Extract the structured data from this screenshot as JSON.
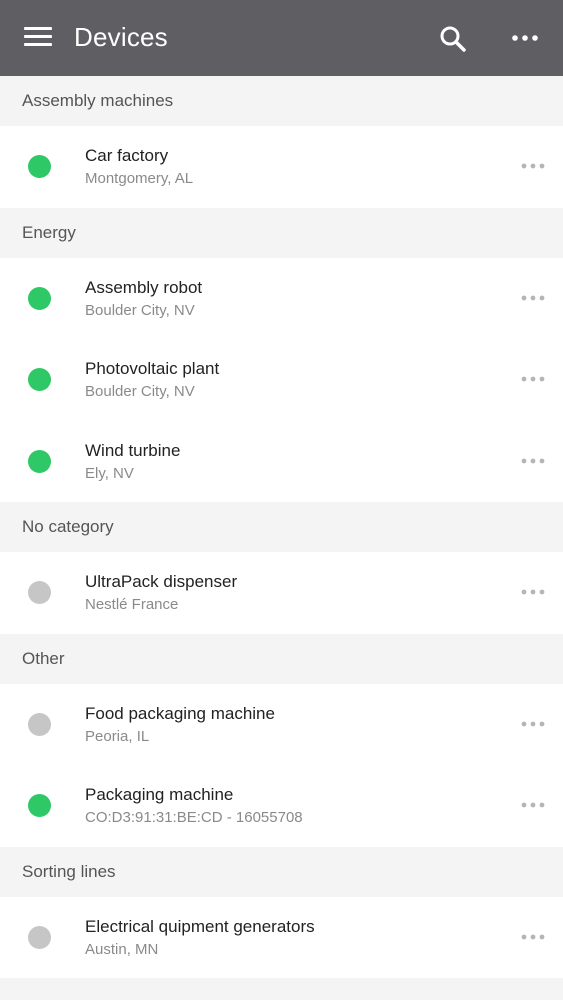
{
  "header": {
    "title": "Devices",
    "menu_icon": "menu-icon",
    "search_icon": "search-icon",
    "more_icon": "more-horizontal-icon"
  },
  "colors": {
    "appbar": "#5f5f63",
    "status_online": "#2ec866",
    "status_offline": "#c6c6c6"
  },
  "sections": [
    {
      "label": "Assembly machines",
      "devices": [
        {
          "name": "Car factory",
          "location": "Montgomery, AL",
          "status": "online"
        }
      ]
    },
    {
      "label": "Energy",
      "devices": [
        {
          "name": "Assembly robot",
          "location": "Boulder City, NV",
          "status": "online"
        },
        {
          "name": "Photovoltaic plant",
          "location": "Boulder City, NV",
          "status": "online"
        },
        {
          "name": "Wind turbine",
          "location": "Ely, NV",
          "status": "online"
        }
      ]
    },
    {
      "label": "No category",
      "devices": [
        {
          "name": "UltraPack dispenser",
          "location": "Nestlé France",
          "status": "offline"
        }
      ]
    },
    {
      "label": "Other",
      "devices": [
        {
          "name": "Food packaging machine",
          "location": "Peoria, IL",
          "status": "offline"
        },
        {
          "name": "Packaging machine",
          "location": "CO:D3:91:31:BE:CD - 16055708",
          "status": "online"
        }
      ]
    },
    {
      "label": "Sorting lines",
      "devices": [
        {
          "name": "Electrical quipment generators",
          "location": "Austin, MN",
          "status": "offline"
        }
      ]
    }
  ]
}
